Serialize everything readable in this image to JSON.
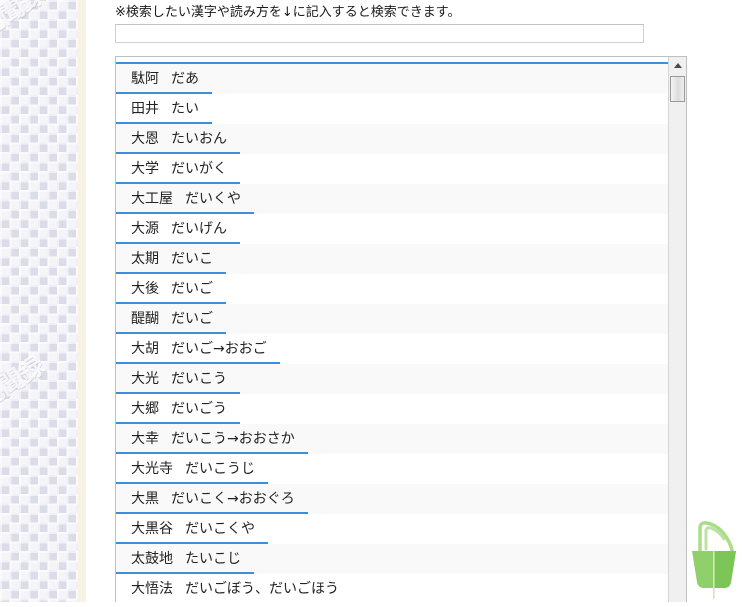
{
  "page": {
    "hint_text": "※検索したい漢字や読み方を↓に記入すると検索できます。",
    "background_color": "#ffffff",
    "accent_color": "#3e8edd"
  },
  "decoration": {
    "watermark_text": "見聞録",
    "tile_color_dark": "#dcdce9",
    "tile_color_light": "#f4f4f9",
    "strip_color": "#f7f2e2"
  },
  "search": {
    "value": "",
    "placeholder": ""
  },
  "list": {
    "row_stripe_color": "#f9f9f9",
    "underline_color": "#3e8edd",
    "items": [
      {
        "kanji": "駄阿",
        "kana": "だあ"
      },
      {
        "kanji": "田井",
        "kana": "たい"
      },
      {
        "kanji": "大恩",
        "kana": "たいおん"
      },
      {
        "kanji": "大学",
        "kana": "だいがく"
      },
      {
        "kanji": "大工屋",
        "kana": "だいくや"
      },
      {
        "kanji": "大源",
        "kana": "だいげん"
      },
      {
        "kanji": "太期",
        "kana": "だいこ"
      },
      {
        "kanji": "大後",
        "kana": "だいご"
      },
      {
        "kanji": "醍醐",
        "kana": "だいご"
      },
      {
        "kanji": "大胡",
        "kana": "だいご→おおご"
      },
      {
        "kanji": "大光",
        "kana": "だいこう"
      },
      {
        "kanji": "大郷",
        "kana": "だいごう"
      },
      {
        "kanji": "大幸",
        "kana": "だいこう→おおさか"
      },
      {
        "kanji": "大光寺",
        "kana": "だいこうじ"
      },
      {
        "kanji": "大黒",
        "kana": "だいこく→おおぐろ"
      },
      {
        "kanji": "大黒谷",
        "kana": "だいこくや"
      },
      {
        "kanji": "太鼓地",
        "kana": "たいこじ"
      },
      {
        "kanji": "大悟法",
        "kana": "だいごぼう、だいごほう"
      }
    ]
  },
  "scrollbar": {
    "up_arrow": "scroll-up-arrow",
    "position": "top"
  },
  "corner": {
    "clip_icon": "binder-clip-icon",
    "clip_color": "#8fd06a",
    "text": ""
  }
}
